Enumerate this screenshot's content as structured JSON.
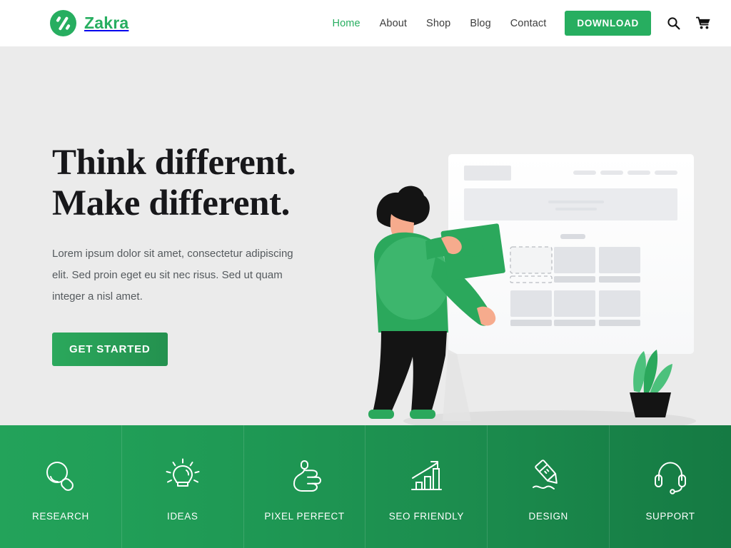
{
  "header": {
    "brand": {
      "name": "Zakra",
      "logo_icon": "zakra-circle-logo",
      "color": "#27ae60"
    },
    "nav": [
      {
        "label": "Home",
        "active": true
      },
      {
        "label": "About",
        "active": false
      },
      {
        "label": "Shop",
        "active": false
      },
      {
        "label": "Blog",
        "active": false
      },
      {
        "label": "Contact",
        "active": false
      }
    ],
    "download_button": {
      "label": "DOWNLOAD",
      "color": "#27ae60"
    },
    "search_icon": "search-icon",
    "cart_icon": "shopping-cart-icon"
  },
  "hero": {
    "title_line1": "Think different.",
    "title_line2": "Make different.",
    "paragraph": "Lorem ipsum dolor sit amet, consectetur adipiscing elit. Sed proin eget eu sit nec risus. Sed ut quam integer a nisl amet.",
    "cta_label": "GET STARTED",
    "background": "#ebebeb",
    "illustration": {
      "name": "person-arranging-website-layout",
      "person_hair_color": "#141414",
      "person_skin_color": "#f6ab8d",
      "person_sweater_color": "#2ba85c",
      "person_pants_color": "#141414",
      "person_shoes_color": "#2ba85c",
      "card_color": "#2ba85c",
      "plant_pot_color": "#141414",
      "plant_leaf_color": "#4cc17c",
      "wireframe_card_color": "#ffffff",
      "wireframe_block_color": "#e2e4e8"
    }
  },
  "features": {
    "gradient_from": "#23a35a",
    "gradient_to": "#157a43",
    "items": [
      {
        "label": "RESEARCH",
        "icon": "magnifier-icon"
      },
      {
        "label": "IDEAS",
        "icon": "lightbulb-icon"
      },
      {
        "label": "PIXEL PERFECT",
        "icon": "thumbs-up-icon"
      },
      {
        "label": "SEO FRIENDLY",
        "icon": "bar-chart-arrow-icon"
      },
      {
        "label": "DESIGN",
        "icon": "pen-drawing-icon"
      },
      {
        "label": "SUPPORT",
        "icon": "headset-icon"
      }
    ]
  }
}
